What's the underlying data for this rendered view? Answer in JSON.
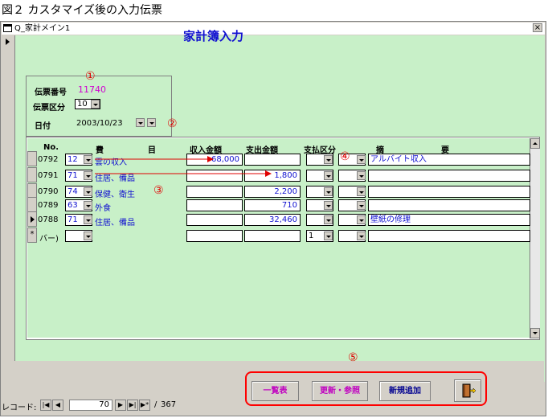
{
  "caption": "図２ カスタマイズ後の入力伝票",
  "window": {
    "title": "Q_家計メイン1",
    "close_glyph": "×"
  },
  "form": {
    "title": "家計簿入力"
  },
  "header": {
    "slip_no_label": "伝票番号",
    "slip_no": "11740",
    "slip_type_label": "伝票区分",
    "slip_type": "10",
    "date_label": "日付",
    "date": "2003/10/23"
  },
  "columns": {
    "no": "No.",
    "himoku_1": "費",
    "himoku_2": "目",
    "income": "収入金額",
    "expense": "支出金額",
    "payment": "支払区分",
    "memo_1": "摘",
    "memo_2": "要"
  },
  "rows": [
    {
      "no": "0792",
      "code": "12",
      "category": "雲の収入",
      "income": "68,000",
      "expense": "",
      "payment": "",
      "memo": "アルバイト収入"
    },
    {
      "no": "0791",
      "code": "71",
      "category": "住居、備品",
      "income": "",
      "expense": "1,800",
      "payment": "",
      "memo": ""
    },
    {
      "no": "0790",
      "code": "74",
      "category": "保健、衛生",
      "income": "",
      "expense": "2,200",
      "payment": "",
      "memo": ""
    },
    {
      "no": "0789",
      "code": "63",
      "category": "外食",
      "income": "",
      "expense": "710",
      "payment": "",
      "memo": ""
    },
    {
      "no": "0788",
      "code": "71",
      "category": "住居、備品",
      "income": "",
      "expense": "32,460",
      "payment": "",
      "memo": "壁紙の修理"
    }
  ],
  "new_row": {
    "marker": "*",
    "no": "バー)",
    "payment": "1"
  },
  "annotations": {
    "a1": "①",
    "a2": "②",
    "a3": "③",
    "a4": "④",
    "a5": "⑤"
  },
  "buttons": {
    "list": "一覧表",
    "update": "更新・参照",
    "add": "新規追加",
    "exit_icon": "exit-door-icon"
  },
  "nav": {
    "label": "レコード:",
    "current": "70",
    "total": "367",
    "sep": "/"
  },
  "colors": {
    "form_bg": "#c8f0c8",
    "accent_blue": "#1010d0",
    "magenta": "#c000c0",
    "annotation_red": "#e00000"
  }
}
